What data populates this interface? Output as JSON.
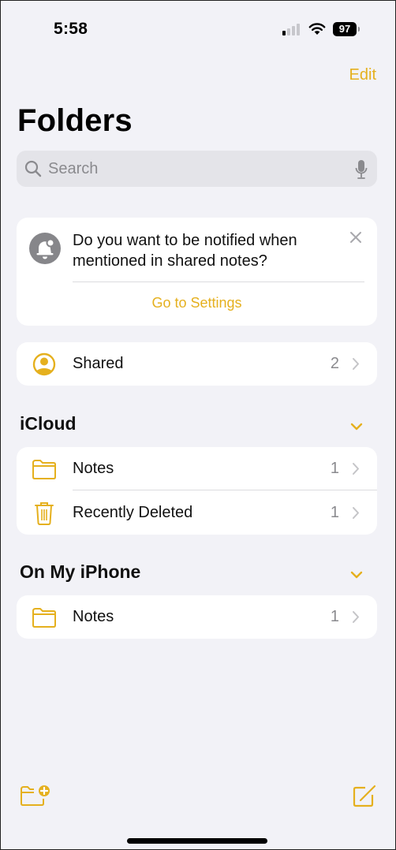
{
  "status_bar": {
    "time": "5:58",
    "signal_bars_active": 1,
    "signal_bars_total": 4,
    "wifi": "wifi-icon",
    "battery_level": "97"
  },
  "nav": {
    "edit_label": "Edit",
    "title": "Folders"
  },
  "search": {
    "placeholder": "Search",
    "value": ""
  },
  "notice": {
    "icon": "bell-icon",
    "message": "Do you want to be notified when mentioned in shared notes?",
    "action_label": "Go to Settings",
    "close_icon": "close-icon"
  },
  "shared": {
    "label": "Shared",
    "count": "2",
    "icon": "person-circle-icon"
  },
  "sections": [
    {
      "title": "iCloud",
      "items": [
        {
          "label": "Notes",
          "count": "1",
          "icon": "folder-icon"
        },
        {
          "label": "Recently Deleted",
          "count": "1",
          "icon": "trash-icon"
        }
      ]
    },
    {
      "title": "On My iPhone",
      "items": [
        {
          "label": "Notes",
          "count": "1",
          "icon": "folder-icon"
        }
      ]
    }
  ],
  "toolbar": {
    "new_folder_icon": "new-folder-icon",
    "compose_icon": "compose-icon"
  },
  "colors": {
    "accent": "#e5b01e",
    "background": "#f2f2f7",
    "card": "#ffffff",
    "secondary_text": "#8a8a8e"
  }
}
